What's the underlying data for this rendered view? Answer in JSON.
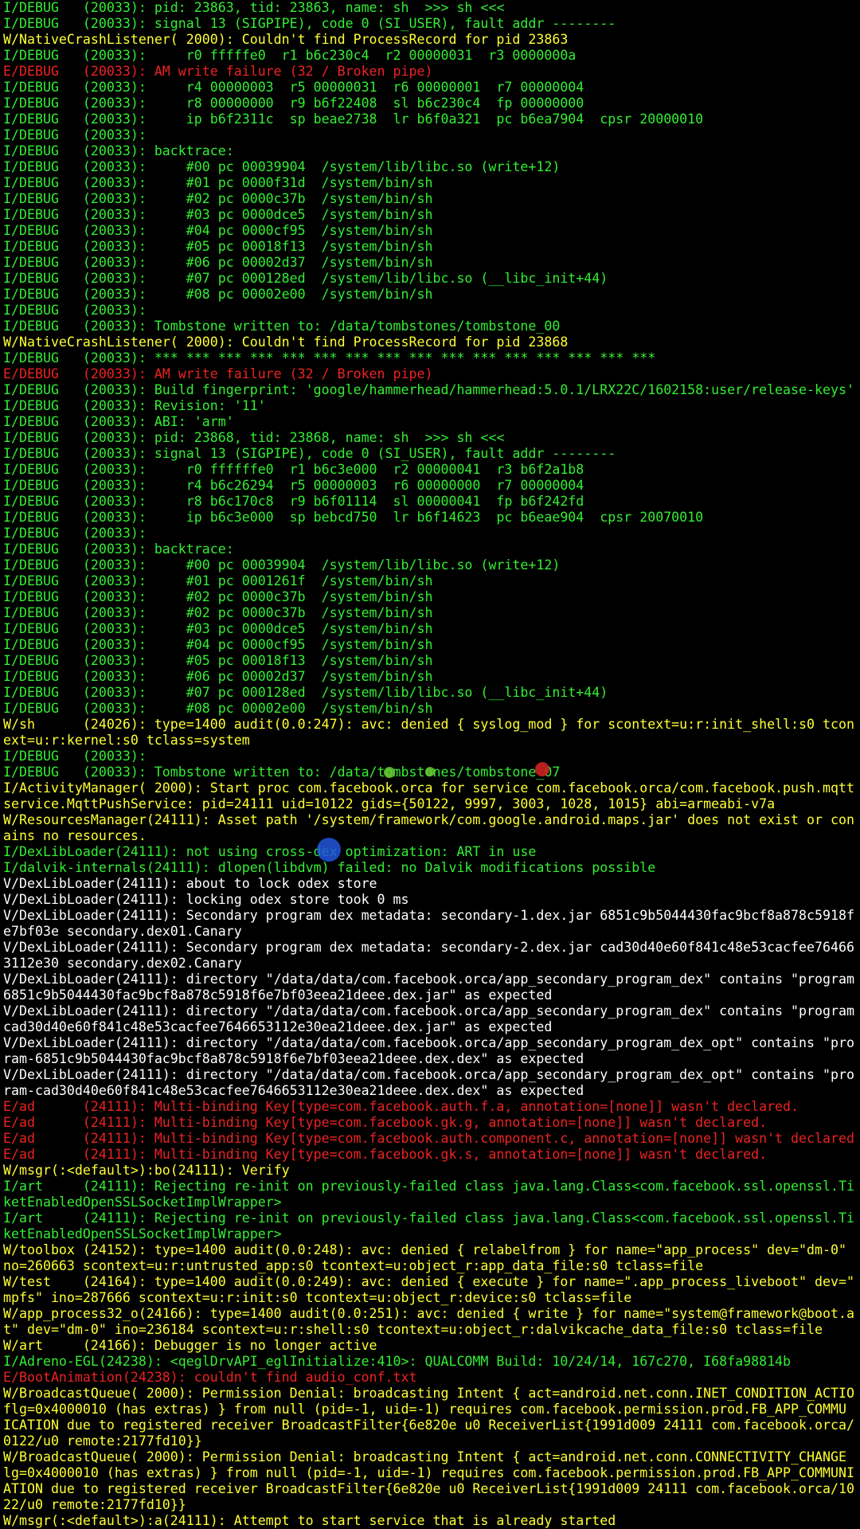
{
  "colors": {
    "background": "#000000",
    "info": "#33ee33",
    "warning": "#ffff33",
    "error": "#ee2222",
    "verbose": "#ffffff",
    "touch_green": "#66cc33",
    "touch_red": "#cc2222",
    "touch_blue": "#2255dd"
  },
  "log_lines": [
    {
      "level": "I",
      "text": "I/DEBUG   (20033): pid: 23863, tid: 23863, name: sh  >>> sh <<<"
    },
    {
      "level": "I",
      "text": "I/DEBUG   (20033): signal 13 (SIGPIPE), code 0 (SI_USER), fault addr --------"
    },
    {
      "level": "W",
      "text": "W/NativeCrashListener( 2000): Couldn't find ProcessRecord for pid 23863"
    },
    {
      "level": "I",
      "text": "I/DEBUG   (20033):     r0 fffffe0  r1 b6c230c4  r2 00000031  r3 0000000a"
    },
    {
      "level": "E",
      "text": "E/DEBUG   (20033): AM write failure (32 / Broken pipe)"
    },
    {
      "level": "I",
      "text": "I/DEBUG   (20033):     r4 00000003  r5 00000031  r6 00000001  r7 00000004"
    },
    {
      "level": "I",
      "text": "I/DEBUG   (20033):     r8 00000000  r9 b6f22408  sl b6c230c4  fp 00000000"
    },
    {
      "level": "I",
      "text": "I/DEBUG   (20033):     ip b6f2311c  sp beae2738  lr b6f0a321  pc b6ea7904  cpsr 20000010"
    },
    {
      "level": "I",
      "text": "I/DEBUG   (20033):"
    },
    {
      "level": "I",
      "text": "I/DEBUG   (20033): backtrace:"
    },
    {
      "level": "I",
      "text": "I/DEBUG   (20033):     #00 pc 00039904  /system/lib/libc.so (write+12)"
    },
    {
      "level": "I",
      "text": "I/DEBUG   (20033):     #01 pc 0000f31d  /system/bin/sh"
    },
    {
      "level": "I",
      "text": "I/DEBUG   (20033):     #02 pc 0000c37b  /system/bin/sh"
    },
    {
      "level": "I",
      "text": "I/DEBUG   (20033):     #03 pc 0000dce5  /system/bin/sh"
    },
    {
      "level": "I",
      "text": "I/DEBUG   (20033):     #04 pc 0000cf95  /system/bin/sh"
    },
    {
      "level": "I",
      "text": "I/DEBUG   (20033):     #05 pc 00018f13  /system/bin/sh"
    },
    {
      "level": "I",
      "text": "I/DEBUG   (20033):     #06 pc 00002d37  /system/bin/sh"
    },
    {
      "level": "I",
      "text": "I/DEBUG   (20033):     #07 pc 000128ed  /system/lib/libc.so (__libc_init+44)"
    },
    {
      "level": "I",
      "text": "I/DEBUG   (20033):     #08 pc 00002e00  /system/bin/sh"
    },
    {
      "level": "I",
      "text": "I/DEBUG   (20033):"
    },
    {
      "level": "I",
      "text": "I/DEBUG   (20033): Tombstone written to: /data/tombstones/tombstone_00"
    },
    {
      "level": "W",
      "text": "W/NativeCrashListener( 2000): Couldn't find ProcessRecord for pid 23868"
    },
    {
      "level": "I",
      "text": "I/DEBUG   (20033): *** *** *** *** *** *** *** *** *** *** *** *** *** *** *** ***"
    },
    {
      "level": "E",
      "text": "E/DEBUG   (20033): AM write failure (32 / Broken pipe)"
    },
    {
      "level": "I",
      "text": "I/DEBUG   (20033): Build fingerprint: 'google/hammerhead/hammerhead:5.0.1/LRX22C/1602158:user/release-keys'"
    },
    {
      "level": "I",
      "text": "I/DEBUG   (20033): Revision: '11'"
    },
    {
      "level": "I",
      "text": "I/DEBUG   (20033): ABI: 'arm'"
    },
    {
      "level": "I",
      "text": "I/DEBUG   (20033): pid: 23868, tid: 23868, name: sh  >>> sh <<<"
    },
    {
      "level": "I",
      "text": "I/DEBUG   (20033): signal 13 (SIGPIPE), code 0 (SI_USER), fault addr --------"
    },
    {
      "level": "I",
      "text": "I/DEBUG   (20033):     r0 ffffffe0  r1 b6c3e000  r2 00000041  r3 b6f2a1b8"
    },
    {
      "level": "I",
      "text": "I/DEBUG   (20033):     r4 b6c26294  r5 00000003  r6 00000000  r7 00000004"
    },
    {
      "level": "I",
      "text": "I/DEBUG   (20033):     r8 b6c170c8  r9 b6f01114  sl 00000041  fp b6f242fd"
    },
    {
      "level": "I",
      "text": "I/DEBUG   (20033):     ip b6c3e000  sp bebcd750  lr b6f14623  pc b6eae904  cpsr 20070010"
    },
    {
      "level": "I",
      "text": "I/DEBUG   (20033):"
    },
    {
      "level": "I",
      "text": "I/DEBUG   (20033): backtrace:"
    },
    {
      "level": "I",
      "text": "I/DEBUG   (20033):     #00 pc 00039904  /system/lib/libc.so (write+12)"
    },
    {
      "level": "I",
      "text": "I/DEBUG   (20033):     #01 pc 0001261f  /system/bin/sh"
    },
    {
      "level": "I",
      "text": "I/DEBUG   (20033):     #02 pc 0000c37b  /system/bin/sh"
    },
    {
      "level": "I",
      "text": "I/DEBUG   (20033):     #02 pc 0000c37b  /system/bin/sh"
    },
    {
      "level": "I",
      "text": "I/DEBUG   (20033):     #03 pc 0000dce5  /system/bin/sh"
    },
    {
      "level": "I",
      "text": "I/DEBUG   (20033):     #04 pc 0000cf95  /system/bin/sh"
    },
    {
      "level": "I",
      "text": "I/DEBUG   (20033):     #05 pc 00018f13  /system/bin/sh"
    },
    {
      "level": "I",
      "text": "I/DEBUG   (20033):     #06 pc 00002d37  /system/bin/sh"
    },
    {
      "level": "I",
      "text": "I/DEBUG   (20033):     #07 pc 000128ed  /system/lib/libc.so (__libc_init+44)"
    },
    {
      "level": "I",
      "text": "I/DEBUG   (20033):     #08 pc 00002e00  /system/bin/sh"
    },
    {
      "level": "W",
      "text": "W/sh      (24026): type=1400 audit(0.0:247): avc: denied { syslog_mod } for scontext=u:r:init_shell:s0 tcon"
    },
    {
      "level": "W",
      "text": "ext=u:r:kernel:s0 tclass=system"
    },
    {
      "level": "I",
      "text": "I/DEBUG   (20033):"
    },
    {
      "level": "I",
      "text": "I/DEBUG   (20033): Tombstone written to: /data/tombstones/tombstone_07"
    },
    {
      "level": "W",
      "text": "I/ActivityManager( 2000): Start proc com.facebook.orca for service com.facebook.orca/com.facebook.push.mqtt"
    },
    {
      "level": "W",
      "text": "service.MqttPushService: pid=24111 uid=10122 gids={50122, 9997, 3003, 1028, 1015} abi=armeabi-v7a"
    },
    {
      "level": "W",
      "text": "W/ResourcesManager(24111): Asset path '/system/framework/com.google.android.maps.jar' does not exist or con"
    },
    {
      "level": "W",
      "text": "ains no resources."
    },
    {
      "level": "I",
      "text": "I/DexLibLoader(24111): not using cross-dex optimization: ART in use"
    },
    {
      "level": "I",
      "text": "I/dalvik-internals(24111): dlopen(libdvm) failed: no Dalvik modifications possible"
    },
    {
      "level": "V",
      "text": "V/DexLibLoader(24111): about to lock odex store"
    },
    {
      "level": "V",
      "text": "V/DexLibLoader(24111): locking odex store took 0 ms"
    },
    {
      "level": "V",
      "text": "V/DexLibLoader(24111): Secondary program dex metadata: secondary-1.dex.jar 6851c9b5044430fac9bcf8a878c5918f"
    },
    {
      "level": "V",
      "text": "e7bf03e secondary.dex01.Canary"
    },
    {
      "level": "V",
      "text": "V/DexLibLoader(24111): Secondary program dex metadata: secondary-2.dex.jar cad30d40e60f841c48e53cacfee76466"
    },
    {
      "level": "V",
      "text": "3112e30 secondary.dex02.Canary"
    },
    {
      "level": "V",
      "text": "V/DexLibLoader(24111): directory \"/data/data/com.facebook.orca/app_secondary_program_dex\" contains \"program"
    },
    {
      "level": "V",
      "text": "6851c9b5044430fac9bcf8a878c5918f6e7bf03eea21deee.dex.jar\" as expected"
    },
    {
      "level": "V",
      "text": "V/DexLibLoader(24111): directory \"/data/data/com.facebook.orca/app_secondary_program_dex\" contains \"program"
    },
    {
      "level": "V",
      "text": "cad30d40e60f841c48e53cacfee7646653112e30ea21deee.dex.jar\" as expected"
    },
    {
      "level": "V",
      "text": "V/DexLibLoader(24111): directory \"/data/data/com.facebook.orca/app_secondary_program_dex_opt\" contains \"pro"
    },
    {
      "level": "V",
      "text": "ram-6851c9b5044430fac9bcf8a878c5918f6e7bf03eea21deee.dex.dex\" as expected"
    },
    {
      "level": "V",
      "text": "V/DexLibLoader(24111): directory \"/data/data/com.facebook.orca/app_secondary_program_dex_opt\" contains \"pro"
    },
    {
      "level": "V",
      "text": "ram-cad30d40e60f841c48e53cacfee7646653112e30ea21deee.dex.dex\" as expected"
    },
    {
      "level": "E",
      "text": "E/ad      (24111): Multi-binding Key[type=com.facebook.auth.f.a, annotation=[none]] wasn't declared."
    },
    {
      "level": "E",
      "text": "E/ad      (24111): Multi-binding Key[type=com.facebook.gk.g, annotation=[none]] wasn't declared."
    },
    {
      "level": "E",
      "text": "E/ad      (24111): Multi-binding Key[type=com.facebook.auth.component.c, annotation=[none]] wasn't declared"
    },
    {
      "level": "E",
      "text": "E/ad      (24111): Multi-binding Key[type=com.facebook.gk.s, annotation=[none]] wasn't declared."
    },
    {
      "level": "W",
      "text": "W/msgr(:<default>):bo(24111): Verify"
    },
    {
      "level": "I",
      "text": "I/art     (24111): Rejecting re-init on previously-failed class java.lang.Class<com.facebook.ssl.openssl.Ti"
    },
    {
      "level": "I",
      "text": "ketEnabledOpenSSLSocketImplWrapper>"
    },
    {
      "level": "I",
      "text": "I/art     (24111): Rejecting re-init on previously-failed class java.lang.Class<com.facebook.ssl.openssl.Ti"
    },
    {
      "level": "I",
      "text": "ketEnabledOpenSSLSocketImplWrapper>"
    },
    {
      "level": "W",
      "text": "W/toolbox (24152): type=1400 audit(0.0:248): avc: denied { relabelfrom } for name=\"app_process\" dev=\"dm-0\""
    },
    {
      "level": "W",
      "text": "no=260663 scontext=u:r:untrusted_app:s0 tcontext=u:object_r:app_data_file:s0 tclass=file"
    },
    {
      "level": "W",
      "text": "W/test    (24164): type=1400 audit(0.0:249): avc: denied { execute } for name=\".app_process_liveboot\" dev=\""
    },
    {
      "level": "W",
      "text": "mpfs\" ino=287666 scontext=u:r:init:s0 tcontext=u:object_r:device:s0 tclass=file"
    },
    {
      "level": "W",
      "text": "W/app_process32_o(24166): type=1400 audit(0.0:251): avc: denied { write } for name=\"system@framework@boot.a"
    },
    {
      "level": "W",
      "text": "t\" dev=\"dm-0\" ino=236184 scontext=u:r:shell:s0 tcontext=u:object_r:dalvikcache_data_file:s0 tclass=file"
    },
    {
      "level": "W",
      "text": "W/art     (24166): Debugger is no longer active"
    },
    {
      "level": "I",
      "text": "I/Adreno-EGL(24238): <qeglDrvAPI_eglInitialize:410>: QUALCOMM Build: 10/24/14, 167c270, I68fa98814b"
    },
    {
      "level": "E",
      "text": "E/BootAnimation(24238): couldn't find audio_conf.txt"
    },
    {
      "level": "W",
      "text": "W/BroadcastQueue( 2000): Permission Denial: broadcasting Intent { act=android.net.conn.INET_CONDITION_ACTIO"
    },
    {
      "level": "W",
      "text": "flg=0x4000010 (has extras) } from null (pid=-1, uid=-1) requires com.facebook.permission.prod.FB_APP_COMMU"
    },
    {
      "level": "W",
      "text": "ICATION due to registered receiver BroadcastFilter{6e820e u0 ReceiverList{1991d009 24111 com.facebook.orca/"
    },
    {
      "level": "W",
      "text": "0122/u0 remote:2177fd10}}"
    },
    {
      "level": "W",
      "text": "W/BroadcastQueue( 2000): Permission Denial: broadcasting Intent { act=android.net.conn.CONNECTIVITY_CHANGE"
    },
    {
      "level": "W",
      "text": "lg=0x4000010 (has extras) } from null (pid=-1, uid=-1) requires com.facebook.permission.prod.FB_APP_COMMUNI"
    },
    {
      "level": "W",
      "text": "ATION due to registered receiver BroadcastFilter{6e820e u0 ReceiverList{1991d009 24111 com.facebook.orca/10"
    },
    {
      "level": "W",
      "text": "22/u0 remote:2177fd10}}"
    },
    {
      "level": "W",
      "text": "W/msgr(:<default>):a(24111): Attempt to start service that is already started"
    }
  ]
}
